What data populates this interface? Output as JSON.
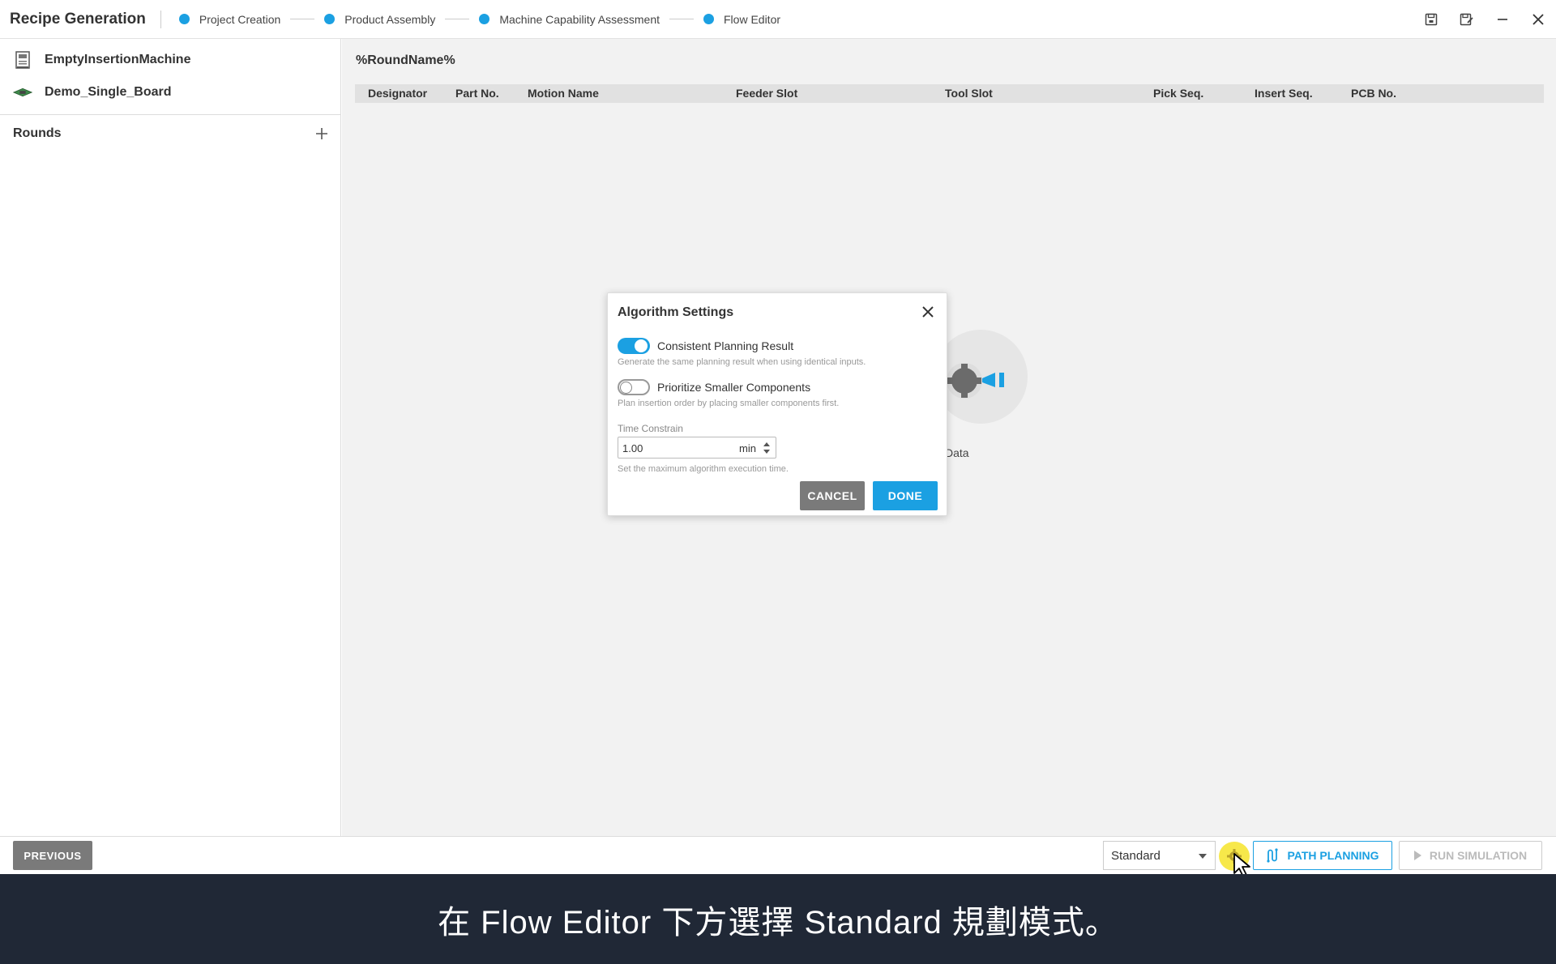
{
  "app": {
    "title": "Recipe Generation"
  },
  "steps": [
    {
      "label": "Project Creation"
    },
    {
      "label": "Product Assembly"
    },
    {
      "label": "Machine Capability Assessment"
    },
    {
      "label": "Flow Editor"
    }
  ],
  "sidebar": {
    "machine": "EmptyInsertionMachine",
    "board": "Demo_Single_Board",
    "rounds_label": "Rounds"
  },
  "main": {
    "round_name": "%RoundName%",
    "columns": [
      "Designator",
      "Part No.",
      "Motion Name",
      "Feeder Slot",
      "Tool Slot",
      "Pick Seq.",
      "Insert Seq.",
      "PCB No."
    ],
    "empty_text": "Data"
  },
  "dialog": {
    "title": "Algorithm Settings",
    "options": [
      {
        "label": "Consistent Planning Result",
        "description": "Generate the same planning result when using identical inputs.",
        "enabled": true
      },
      {
        "label": "Prioritize Smaller Components",
        "description": "Plan insertion order by placing smaller components first.",
        "enabled": false
      }
    ],
    "time_label": "Time Constrain",
    "time_value": "1.00",
    "time_unit": "min",
    "time_hint": "Set the maximum algorithm execution time.",
    "cancel_label": "CANCEL",
    "done_label": "DONE"
  },
  "bottom": {
    "previous_label": "PREVIOUS",
    "mode_value": "Standard",
    "path_planning_label": "PATH PLANNING",
    "run_simulation_label": "RUN SIMULATION"
  },
  "caption": "在 Flow Editor 下方選擇 Standard 規劃模式。",
  "colors": {
    "accent": "#1ba0e2",
    "button_gray": "#7a7a7a",
    "caption_bg": "#202836",
    "highlight": "#f7e84a"
  }
}
